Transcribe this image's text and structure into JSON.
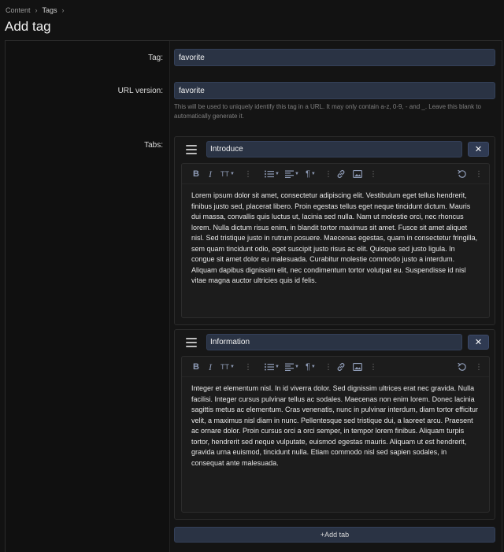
{
  "breadcrumb": {
    "items": [
      "Content",
      "Tags"
    ]
  },
  "page_title": "Add tag",
  "form": {
    "tag_label": "Tag:",
    "tag_value": "favorite",
    "url_label": "URL version:",
    "url_value": "favorite",
    "url_help": "This will be used to uniquely identify this tag in a URL. It may only contain a-z, 0-9, - and _. Leave this blank to automatically generate it.",
    "tabs_label": "Tabs:"
  },
  "icons": {
    "breadcrumb_separator": "chevron-right-icon",
    "drag": "drag-handle-icon",
    "remove": "close-icon",
    "add": "plus-icon"
  },
  "remove_symbol": "✕",
  "tabs": [
    {
      "name": "Introduce",
      "content": "Lorem ipsum dolor sit amet, consectetur adipiscing elit. Vestibulum eget tellus hendrerit, finibus justo sed, placerat libero. Proin egestas tellus eget neque tincidunt dictum. Mauris dui massa, convallis quis luctus ut, lacinia sed nulla. Nam ut molestie orci, nec rhoncus lorem. Nulla dictum risus enim, in blandit tortor maximus sit amet. Fusce sit amet aliquet nisl. Sed tristique justo in rutrum posuere. Maecenas egestas, quam in consectetur fringilla, sem quam tincidunt odio, eget suscipit justo risus ac elit. Quisque sed justo ligula. In congue sit amet dolor eu malesuada. Curabitur molestie commodo justo a interdum. Aliquam dapibus dignissim elit, nec condimentum tortor volutpat eu. Suspendisse id nisl vitae magna auctor ultricies quis id felis."
    },
    {
      "name": "Information",
      "content": "Integer et elementum nisl. In id viverra dolor. Sed dignissim ultrices erat nec gravida. Nulla facilisi. Integer cursus pulvinar tellus ac sodales. Maecenas non enim lorem. Donec lacinia sagittis metus ac elementum. Cras venenatis, nunc in pulvinar interdum, diam tortor efficitur velit, a maximus nisl diam in nunc. Pellentesque sed tristique dui, a laoreet arcu. Praesent ac ornare dolor. Proin cursus orci a orci semper, in tempor lorem finibus. Aliquam turpis tortor, hendrerit sed neque vulputate, euismod egestas mauris. Aliquam ut est hendrerit, gravida urna euismod, tincidunt nulla. Etiam commodo nisl sed sapien sodales, in consequat ante malesuada."
    }
  ],
  "toolbar": {
    "bold": "B",
    "italic": "I",
    "text_size": "TT",
    "more": "⋮"
  },
  "add_tab_label": "+Add tab",
  "colors": {
    "background": "#121212",
    "input_bg": "#2a3344",
    "toolbar_icon": "#8e9bb6"
  }
}
